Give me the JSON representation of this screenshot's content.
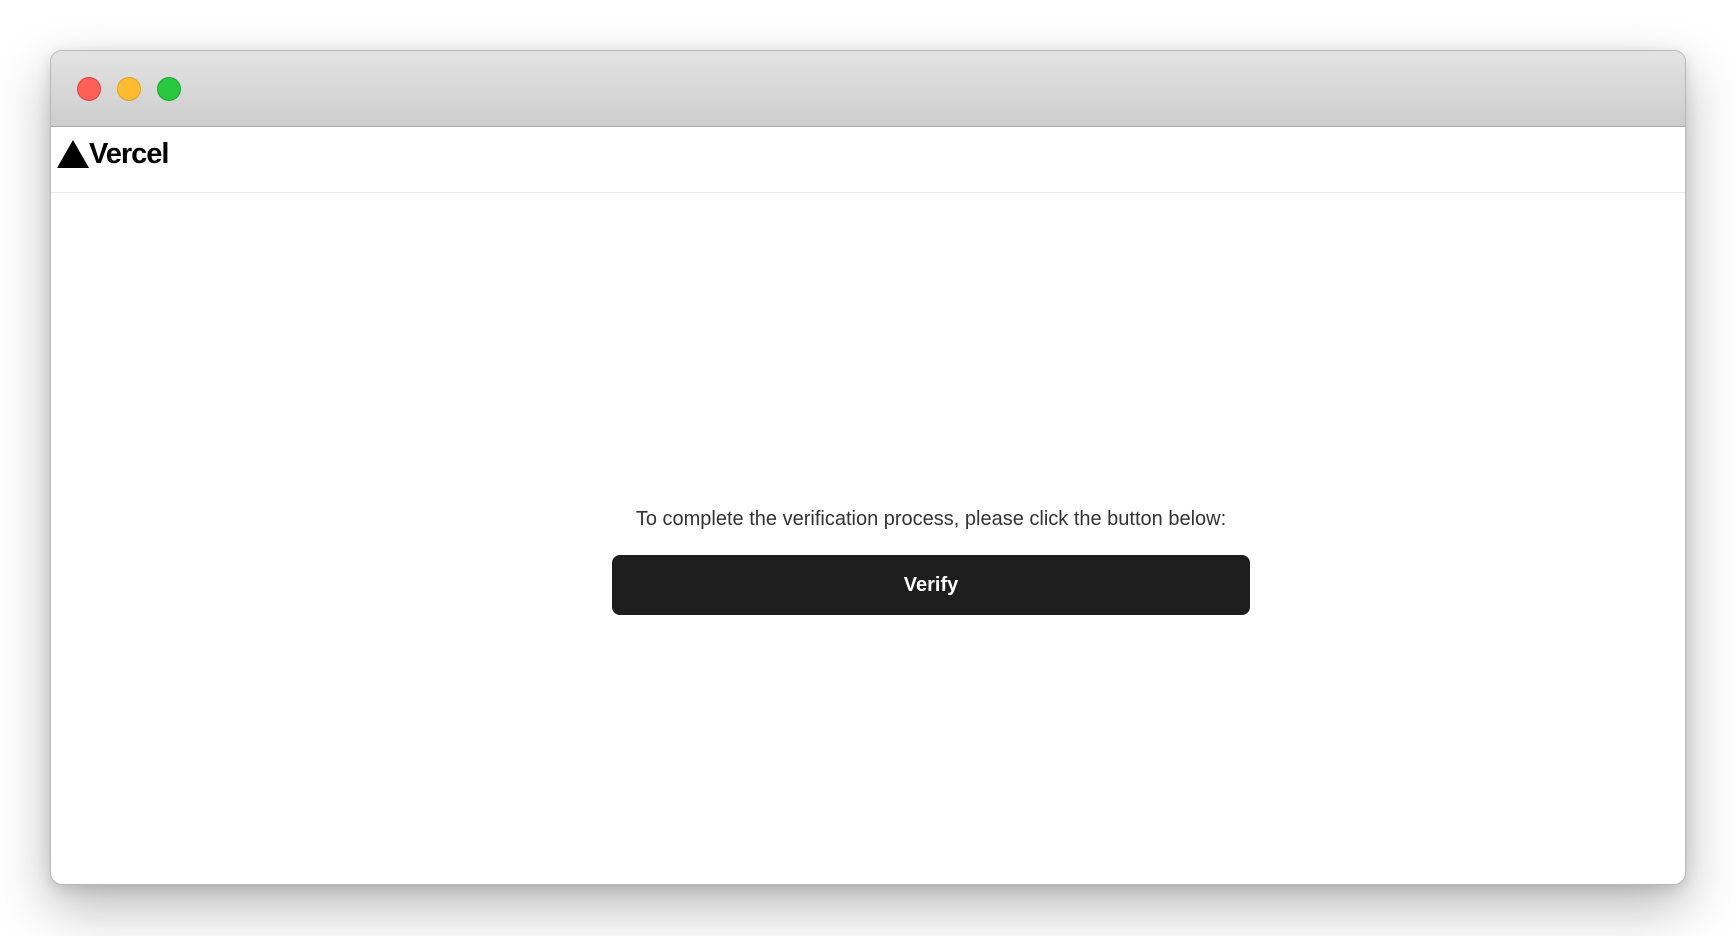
{
  "window": {
    "controls": [
      "close",
      "minimize",
      "zoom"
    ]
  },
  "header": {
    "logo_icon": "triangle-logo-icon",
    "logo_text": "Vercel"
  },
  "main": {
    "instruction": "To complete the verification process, please click the button below:",
    "verify_label": "Verify"
  },
  "colors": {
    "button_bg": "#1e1e1e",
    "button_text": "#ffffff",
    "close": "#fe5f57",
    "minimize": "#febc2e",
    "zoom": "#28c840"
  }
}
